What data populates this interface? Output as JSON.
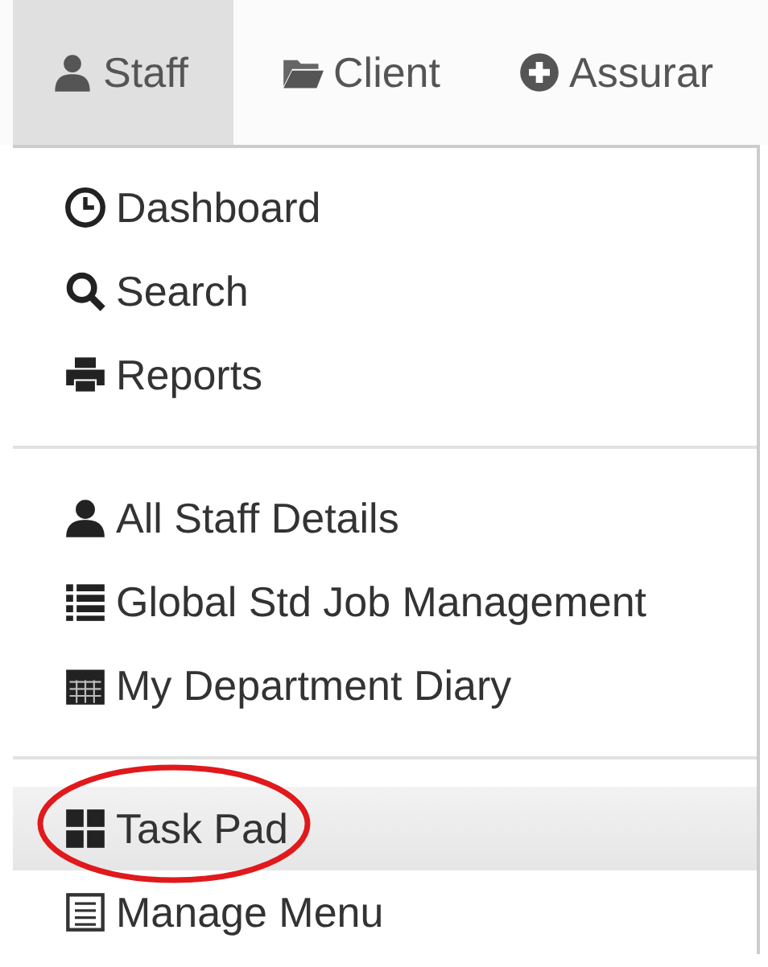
{
  "nav": {
    "tabs": [
      {
        "label": "Staff",
        "selected": true
      },
      {
        "label": "Client",
        "selected": false
      },
      {
        "label": "Assurar",
        "selected": false
      }
    ]
  },
  "menu": {
    "groups": [
      {
        "items": [
          {
            "label": "Dashboard",
            "selected": false
          },
          {
            "label": "Search",
            "selected": false
          },
          {
            "label": "Reports",
            "selected": false
          }
        ]
      },
      {
        "items": [
          {
            "label": "All Staff Details",
            "selected": false
          },
          {
            "label": "Global Std Job Management",
            "selected": false
          },
          {
            "label": "My Department Diary",
            "selected": false
          }
        ]
      },
      {
        "items": [
          {
            "label": "Task Pad",
            "selected": true
          },
          {
            "label": "Manage Menu",
            "selected": false
          }
        ]
      }
    ]
  }
}
